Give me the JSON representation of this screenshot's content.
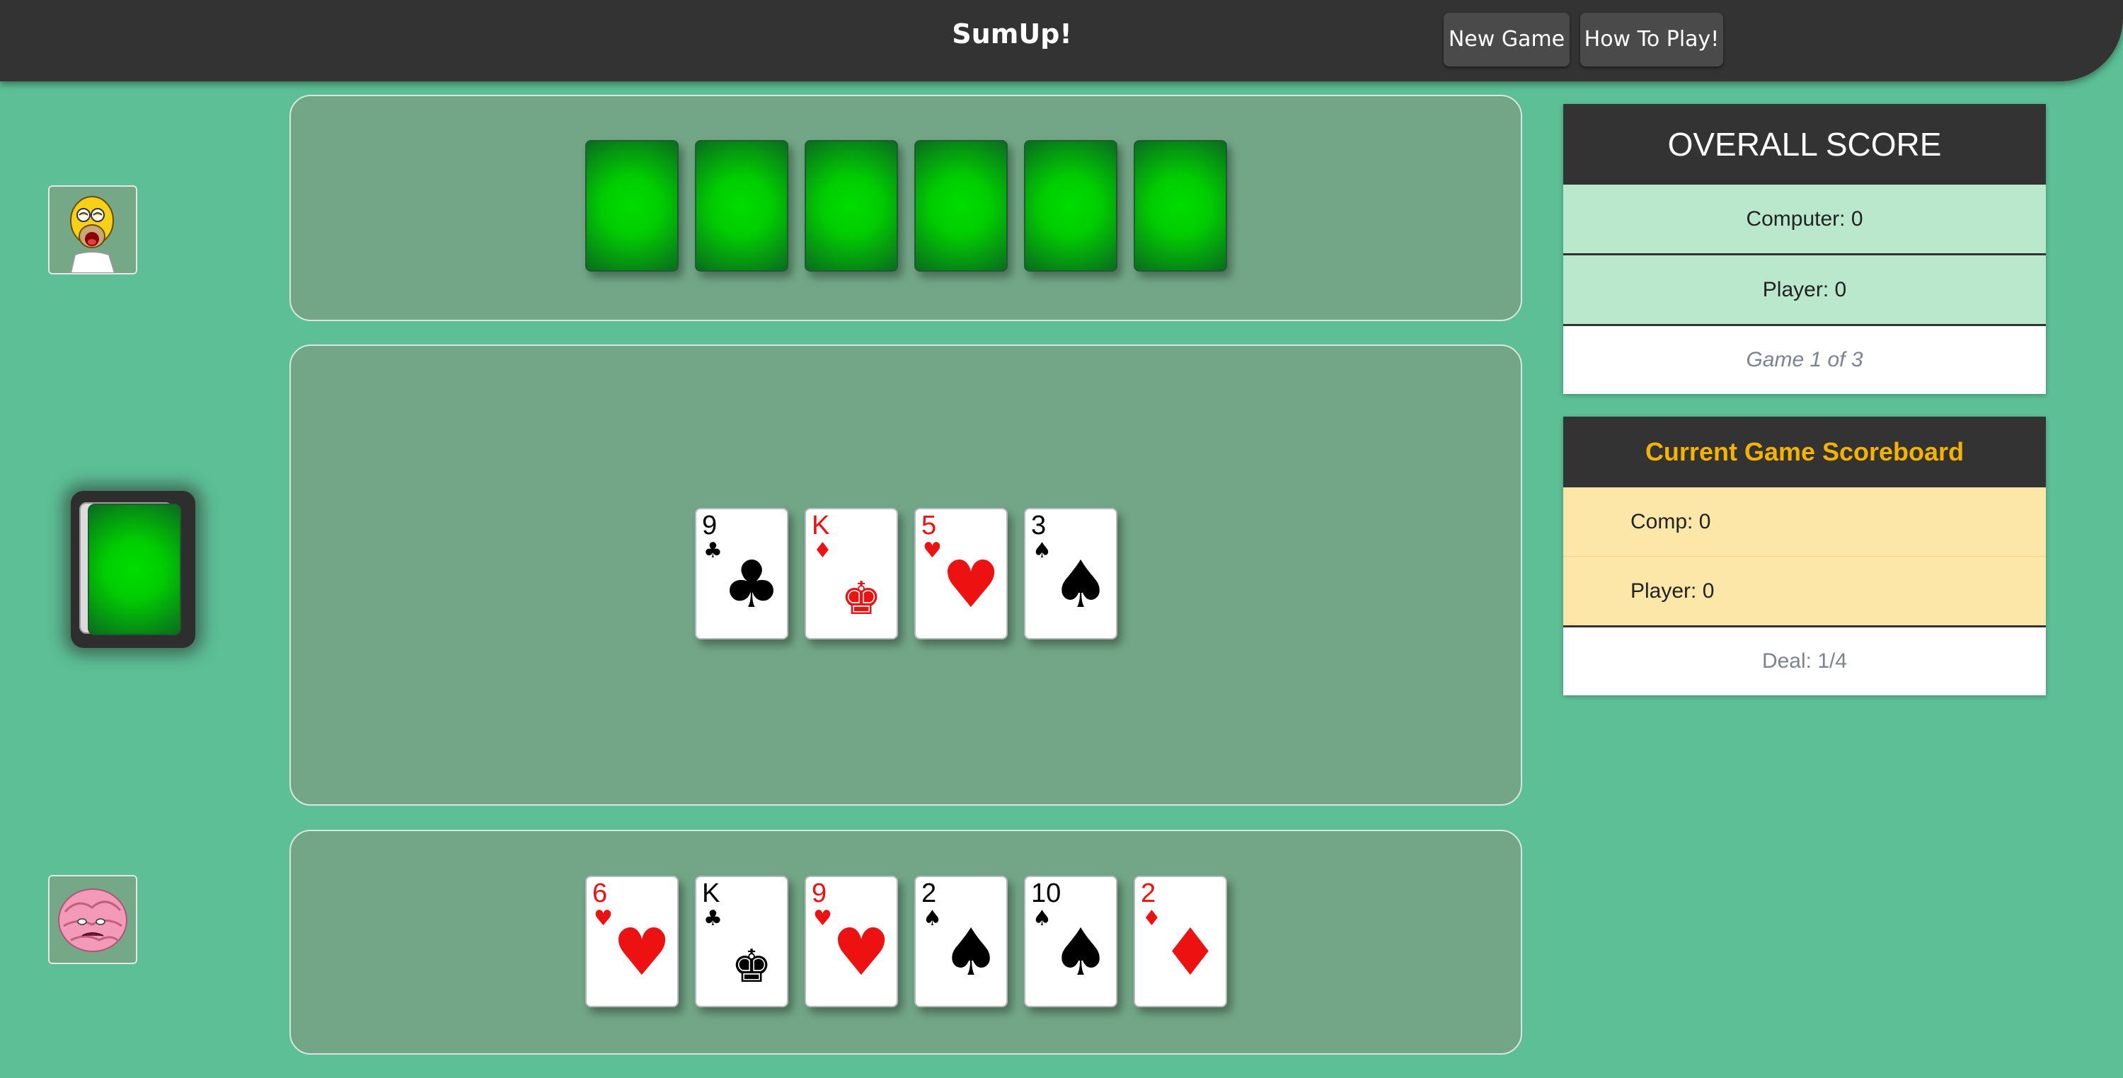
{
  "header": {
    "title": "SumUp!",
    "new_game_label": "New Game",
    "how_to_play_label": "How To Play!"
  },
  "computer_hand": {
    "face_down_count": 6
  },
  "table_cards": [
    {
      "rank": "9",
      "suit": "♣",
      "color": "black"
    },
    {
      "rank": "K",
      "suit": "♦",
      "color": "red",
      "center": "♚"
    },
    {
      "rank": "5",
      "suit": "♥",
      "color": "red"
    },
    {
      "rank": "3",
      "suit": "♠",
      "color": "black"
    }
  ],
  "player_hand": [
    {
      "rank": "6",
      "suit": "♥",
      "color": "red"
    },
    {
      "rank": "K",
      "suit": "♣",
      "color": "black",
      "center": "♚"
    },
    {
      "rank": "9",
      "suit": "♥",
      "color": "red"
    },
    {
      "rank": "2",
      "suit": "♠",
      "color": "black"
    },
    {
      "rank": "10",
      "suit": "♠",
      "color": "black"
    },
    {
      "rank": "2",
      "suit": "♦",
      "color": "red"
    }
  ],
  "overall_score": {
    "title": "OVERALL SCORE",
    "computer": "Computer: 0",
    "player": "Player: 0",
    "game_status": "Game 1 of 3"
  },
  "current_game": {
    "title": "Current Game Scoreboard",
    "comp": "Comp: 0",
    "player": "Player: 0",
    "deal": "Deal: 1/4"
  },
  "colors": {
    "felt": "#5cbf95",
    "panel": "#72a686",
    "card_back": "#00cc00",
    "accent_yellow": "#f5b300"
  }
}
